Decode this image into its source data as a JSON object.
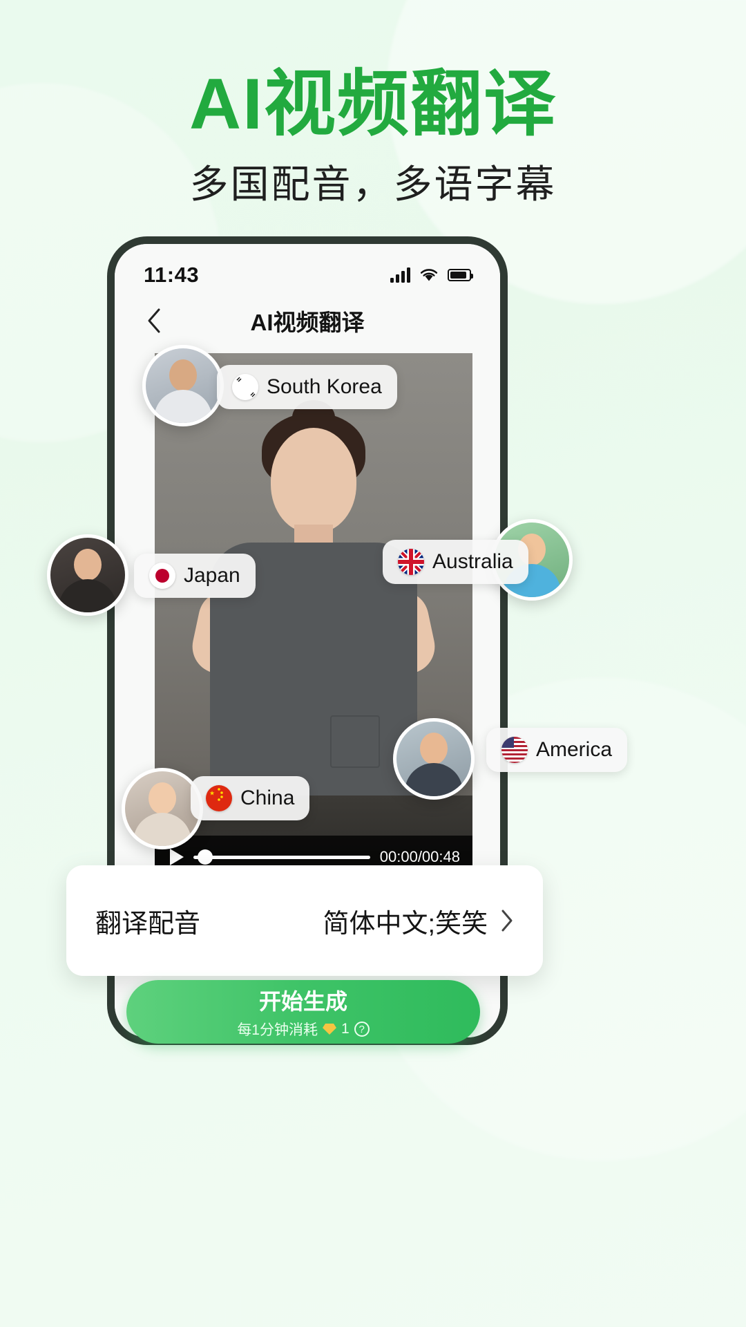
{
  "poster": {
    "title": "AI视频翻译",
    "subtitle": "多国配音，多语字幕",
    "accent_color": "#22aa3f",
    "background_color": "#eafaee"
  },
  "phone": {
    "status_bar": {
      "time": "11:43",
      "signal_icon": "signal-bars-icon",
      "wifi_icon": "wifi-icon",
      "battery_icon": "battery-icon"
    },
    "nav": {
      "back_icon": "chevron-left-icon",
      "title": "AI视频翻译"
    },
    "player": {
      "play_icon": "play-icon",
      "progress_percent": 2,
      "current_time": "00:00",
      "total_time": "00:48",
      "time_display": "00:00/00:48"
    },
    "chips": [
      {
        "label": "South Korea",
        "flag_icon": "flag-south-korea-icon"
      },
      {
        "label": "Japan",
        "flag_icon": "flag-japan-icon"
      },
      {
        "label": "Australia",
        "flag_icon": "flag-australia-icon"
      },
      {
        "label": "America",
        "flag_icon": "flag-usa-icon"
      },
      {
        "label": "China",
        "flag_icon": "flag-china-icon"
      }
    ],
    "avatars": [
      {
        "name": "avatar-south-korea"
      },
      {
        "name": "avatar-japan"
      },
      {
        "name": "avatar-australia"
      },
      {
        "name": "avatar-america"
      },
      {
        "name": "avatar-china"
      }
    ],
    "settings_row": {
      "label": "翻译配音",
      "value": "简体中文;笑笑",
      "chevron_icon": "chevron-right-icon"
    },
    "cta": {
      "label": "开始生成",
      "cost_prefix": "每1分钟消耗",
      "cost_value": "1",
      "gem_icon": "gem-icon",
      "help_icon": "question-mark-icon",
      "gradient_start": "#5ed17d",
      "gradient_end": "#2fbb5c"
    }
  }
}
